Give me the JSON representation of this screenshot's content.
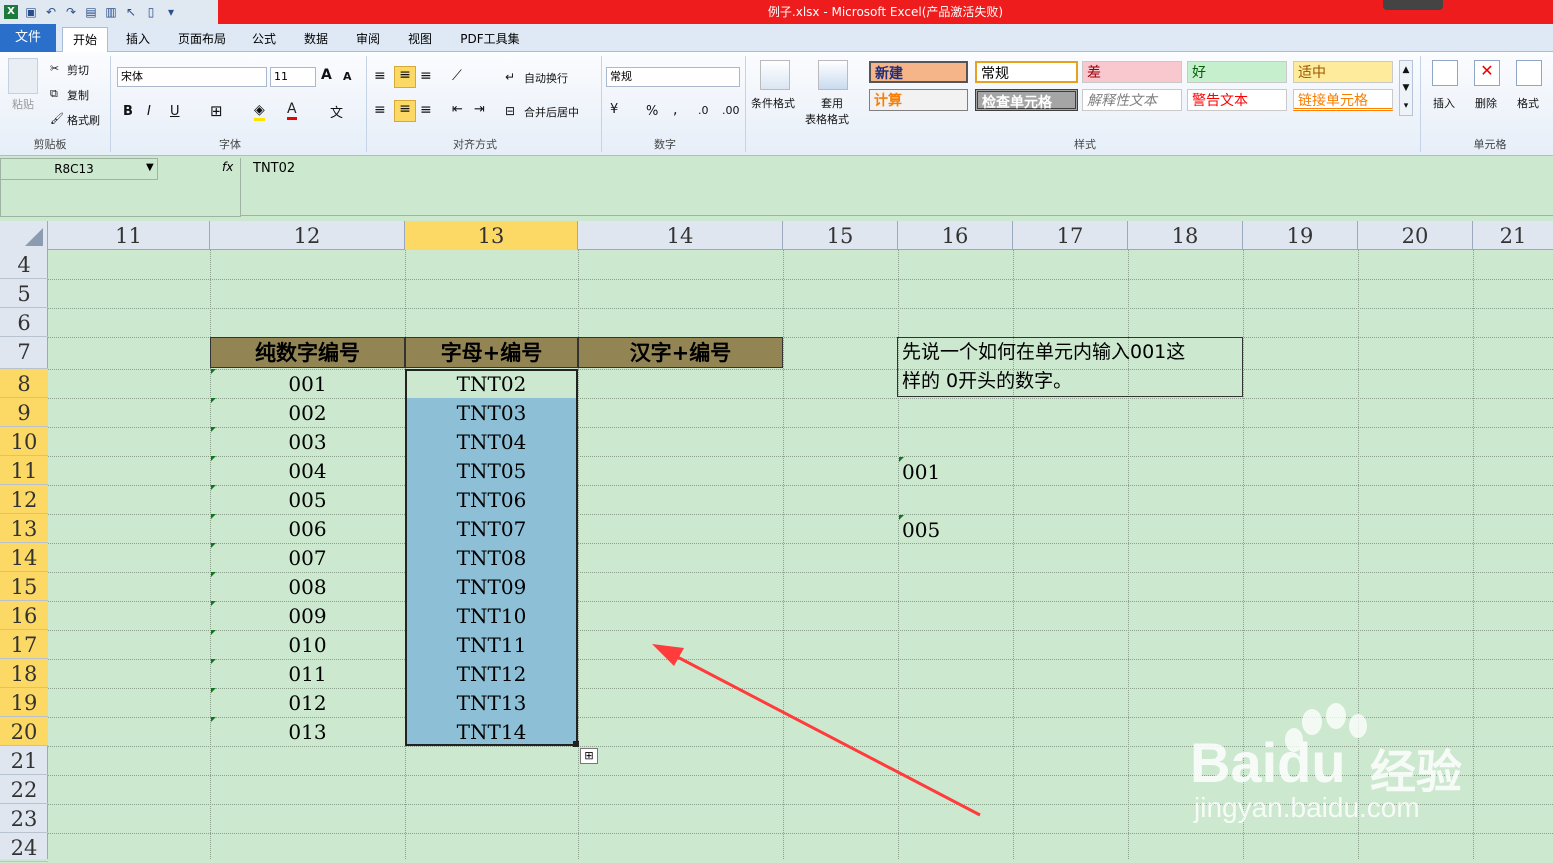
{
  "title": "例子.xlsx - Microsoft Excel(产品激活失败)",
  "tabs": [
    "文件",
    "开始",
    "插入",
    "页面布局",
    "公式",
    "数据",
    "审阅",
    "视图",
    "PDF工具集"
  ],
  "ribbon": {
    "clipboard": {
      "paste": "粘贴",
      "cut": "剪切",
      "copy": "复制",
      "format_painter": "格式刷",
      "label": "剪贴板"
    },
    "font": {
      "name": "宋体",
      "size": "11",
      "label": "字体",
      "grow": "A",
      "shrink": "A",
      "bold": "B",
      "italic": "I",
      "underline": "U"
    },
    "alignment": {
      "wrap": "自动换行",
      "merge": "合并后居中",
      "label": "对齐方式"
    },
    "number": {
      "format": "常规",
      "percent": "%",
      "comma": ",",
      "label": "数字"
    },
    "styles": {
      "conditional": "条件格式",
      "table": "套用",
      "table2": "表格格式",
      "label": "样式",
      "cells": [
        "新建",
        "常规",
        "差",
        "好",
        "适中",
        "计算",
        "检查单元格",
        "解释性文本",
        "警告文本",
        "链接单元格"
      ]
    },
    "cells": {
      "insert": "插入",
      "delete": "删除",
      "format": "格式",
      "label": "单元格"
    }
  },
  "formula_bar": {
    "name_box": "R8C13",
    "fx": "fx",
    "content": "TNT02"
  },
  "columns": [
    "11",
    "12",
    "13",
    "14",
    "15",
    "16",
    "17",
    "18",
    "19",
    "20",
    "21"
  ],
  "rows": [
    "4",
    "5",
    "6",
    "7",
    "8",
    "9",
    "10",
    "11",
    "12",
    "13",
    "14",
    "15",
    "16",
    "17",
    "18",
    "19",
    "20",
    "21",
    "22",
    "23",
    "24"
  ],
  "headers": {
    "col12": "纯数字编号",
    "col13": "字母+编号",
    "col14": "汉字+编号"
  },
  "col12_values": [
    "001",
    "002",
    "003",
    "004",
    "005",
    "006",
    "007",
    "008",
    "009",
    "010",
    "011",
    "012",
    "013"
  ],
  "col13_values": [
    "TNT02",
    "TNT03",
    "TNT04",
    "TNT05",
    "TNT06",
    "TNT07",
    "TNT08",
    "TNT09",
    "TNT10",
    "TNT11",
    "TNT12",
    "TNT13",
    "TNT14"
  ],
  "note": {
    "line1": "先说一个如何在单元内输入001这",
    "line2": "样的 0开头的数字。"
  },
  "col16_values": {
    "r11": "001",
    "r13": "005"
  },
  "watermark": {
    "brand": "Bai",
    "brand2": "du",
    "cn": "经验",
    "url": "jingyan.baidu.com"
  }
}
